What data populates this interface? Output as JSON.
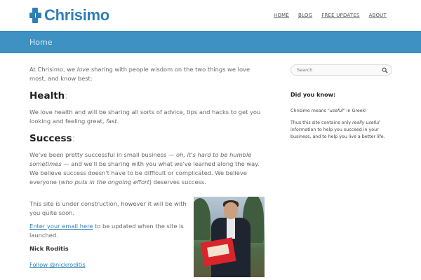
{
  "site": {
    "name": "Chrisimo",
    "nav": [
      "HOME",
      "BLOG",
      "FREE UPDATES",
      "ABOUT"
    ]
  },
  "banner": {
    "title": "Home"
  },
  "main": {
    "intro_pre": "At Chrisimo, we ",
    "intro_em": "love",
    "intro_post": " sharing with people wisdom on the two things we love most, and know best:",
    "health_heading": "Health",
    "health_text_pre": "We love health and will be sharing all sorts of advice, tips and hacks to get you looking and feeling great, ",
    "health_text_em": "fast",
    "health_text_post": ".",
    "success_heading": "Success",
    "success_pre": "We've been pretty successful in small business — ",
    "success_em1": "oh, it's hard to be humble sometimes",
    "success_mid": "  — and we'll be sharing with you what we've learned along the way. We believe success doesn't have to be difficult or complicated. We believe everyone (",
    "success_em2": "who puts in the ongoing effort",
    "success_post": ") deserves success.",
    "construction": "This site is under construction, however it will be with you quite soon.",
    "email_link": "Enter your email here",
    "email_post": " to be updated when the site is launched.",
    "author": "Nick Roditis",
    "twitter_link": "Follow @nickroditis"
  },
  "sidebar": {
    "search_placeholder": "Search",
    "did_you_know": "Did you know:",
    "meaning_pre": "Chrisimo means \"",
    "meaning_em": "useful",
    "meaning_post": "\" in Greek!",
    "para_pre": "Thus this site contains only ",
    "para_em": "really useful",
    "para_post": " information to help you succeed in your business, and to help you live a better life."
  },
  "colors": {
    "brand": "#2f7fb5",
    "banner": "#3d91c3"
  }
}
